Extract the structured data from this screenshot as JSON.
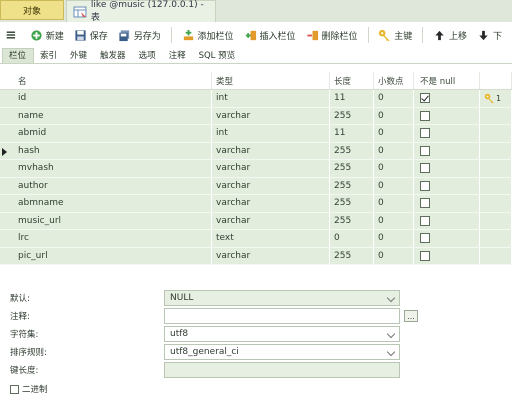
{
  "tabs": {
    "objects": "对象",
    "table_tab": "like @music (127.0.0.1) - 表"
  },
  "toolbar": {
    "new": "新建",
    "save": "保存",
    "save_as": "另存为",
    "add_field": "添加栏位",
    "insert_field": "插入栏位",
    "delete_field": "删除栏位",
    "primary_key": "主键",
    "move_up": "上移",
    "move_down": "下"
  },
  "subtabs": [
    "栏位",
    "索引",
    "外键",
    "触发器",
    "选项",
    "注释",
    "SQL 预览"
  ],
  "columns": {
    "name": "名",
    "type": "类型",
    "length": "长度",
    "decimals": "小数点",
    "not_null": "不是 null"
  },
  "rows": [
    {
      "name": "id",
      "type": "int",
      "length": "11",
      "decimals": "0",
      "not_null": true,
      "key": "1"
    },
    {
      "name": "name",
      "type": "varchar",
      "length": "255",
      "decimals": "0",
      "not_null": false,
      "key": ""
    },
    {
      "name": "abmid",
      "type": "int",
      "length": "11",
      "decimals": "0",
      "not_null": false,
      "key": ""
    },
    {
      "name": "hash",
      "type": "varchar",
      "length": "255",
      "decimals": "0",
      "not_null": false,
      "key": ""
    },
    {
      "name": "mvhash",
      "type": "varchar",
      "length": "255",
      "decimals": "0",
      "not_null": false,
      "key": ""
    },
    {
      "name": "author",
      "type": "varchar",
      "length": "255",
      "decimals": "0",
      "not_null": false,
      "key": ""
    },
    {
      "name": "abmname",
      "type": "varchar",
      "length": "255",
      "decimals": "0",
      "not_null": false,
      "key": ""
    },
    {
      "name": "music_url",
      "type": "varchar",
      "length": "255",
      "decimals": "0",
      "not_null": false,
      "key": ""
    },
    {
      "name": "lrc",
      "type": "text",
      "length": "0",
      "decimals": "0",
      "not_null": false,
      "key": ""
    },
    {
      "name": "pic_url",
      "type": "varchar",
      "length": "255",
      "decimals": "0",
      "not_null": false,
      "key": ""
    }
  ],
  "current_row_index": 3,
  "props": {
    "default_label": "默认:",
    "default_value": "NULL",
    "comment_label": "注释:",
    "comment_value": "",
    "charset_label": "字符集:",
    "charset_value": "utf8",
    "collation_label": "排序规则:",
    "collation_value": "utf8_general_ci",
    "key_length_label": "键长度:",
    "key_length_value": "",
    "binary_label": "二进制",
    "ellipsis": "..."
  },
  "colors": {
    "row_bg": "#e3edde",
    "tab_objects_bg": "#efe08a",
    "key_icon": "#e8b52a"
  },
  "icons": [
    "menu-icon",
    "new-icon",
    "save-icon",
    "save-as-icon",
    "add-field-icon",
    "insert-field-icon",
    "delete-field-icon",
    "key-icon",
    "arrow-up-icon",
    "arrow-down-icon",
    "table-icon"
  ]
}
